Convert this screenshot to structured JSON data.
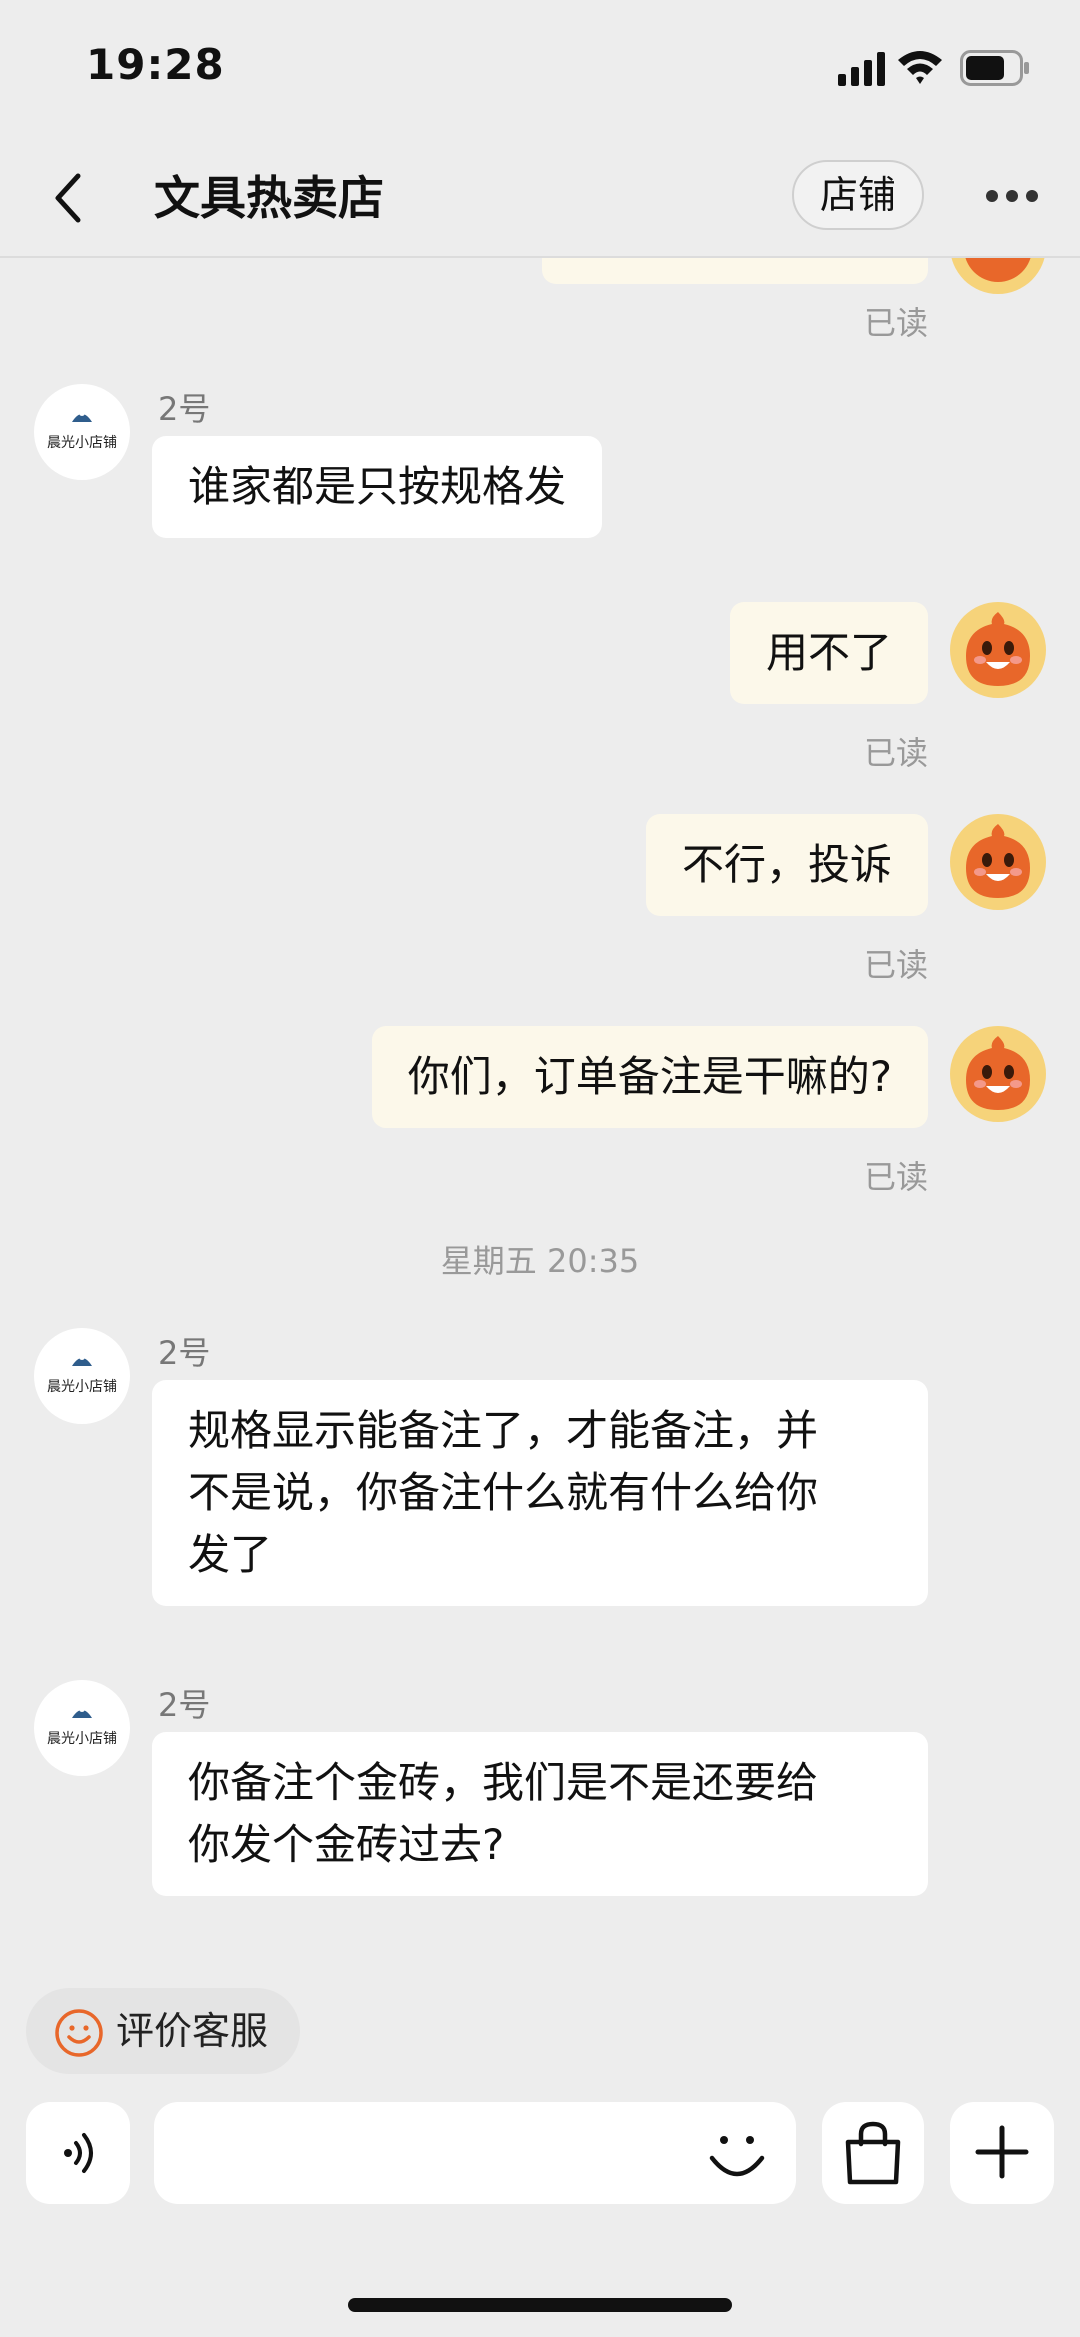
{
  "status_bar": {
    "time": "19:28"
  },
  "header": {
    "title": "文具热卖店",
    "shop_button": "店铺"
  },
  "shop_avatar_text": "晨光小店铺",
  "messages": [
    {
      "read": "已读"
    },
    {
      "sender": "2号",
      "text": "谁家都是只按规格发"
    },
    {
      "text": "用不了",
      "read": "已读"
    },
    {
      "text": "不行，投诉",
      "read": "已读"
    },
    {
      "text": "你们，订单备注是干嘛的?",
      "read": "已读"
    },
    {
      "timestamp": "星期五 20:35"
    },
    {
      "sender": "2号",
      "lines": [
        "规格显示能备注了，才能备注，并",
        "不是说，你备注什么就有什么给你",
        "发了"
      ]
    },
    {
      "sender": "2号",
      "lines": [
        "你备注个金砖，我们是不是还要给",
        "你发个金砖过去?"
      ]
    }
  ],
  "rate_chip": {
    "label": "评价客服"
  },
  "colors": {
    "incoming_bubble": "#ffffff",
    "outgoing_bubble": "#fcf8ea",
    "background": "#ededed",
    "accent_orange": "#e8672a"
  },
  "icons": [
    "back-arrow-icon",
    "more-dots-icon",
    "voice-icon",
    "emoji-icon",
    "shopping-bag-icon",
    "plus-icon",
    "smile-icon"
  ]
}
